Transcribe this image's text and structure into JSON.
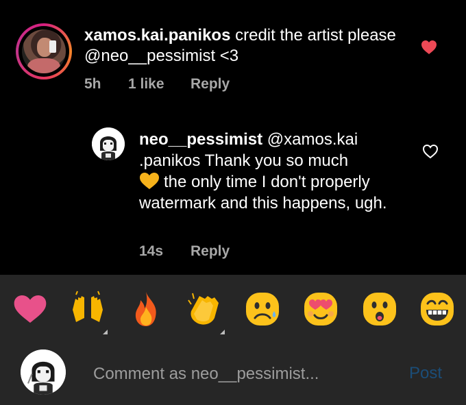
{
  "comment": {
    "username": "xamos.kai.panikos",
    "text": " credit the artist please @neo__pessimist <3",
    "time": "5h",
    "likes": "1 like",
    "reply_label": "Reply",
    "liked": true
  },
  "reply": {
    "username": "neo__pessimist",
    "mention": " @xamos.kai .panikos",
    "text_a": " Thank you so much",
    "text_b": "the only time I don't properly watermark and this happens, ugh.",
    "time": "14s",
    "reply_label": "Reply",
    "liked": false
  },
  "reactions": [
    {
      "icon": "red-heart-icon"
    },
    {
      "icon": "raising-hands-icon"
    },
    {
      "icon": "fire-icon"
    },
    {
      "icon": "clapping-hands-icon"
    },
    {
      "icon": "sad-face-icon"
    },
    {
      "icon": "heart-eyes-face-icon"
    },
    {
      "icon": "surprised-face-icon"
    },
    {
      "icon": "grinning-face-icon"
    }
  ],
  "composer": {
    "placeholder": "Comment as neo__pessimist...",
    "post_label": "Post"
  },
  "colors": {
    "background": "#000000",
    "bar": "#262626",
    "secondary_text": "#a8a8a8",
    "like_red": "#ed4956",
    "post_disabled": "#1b4d78"
  }
}
